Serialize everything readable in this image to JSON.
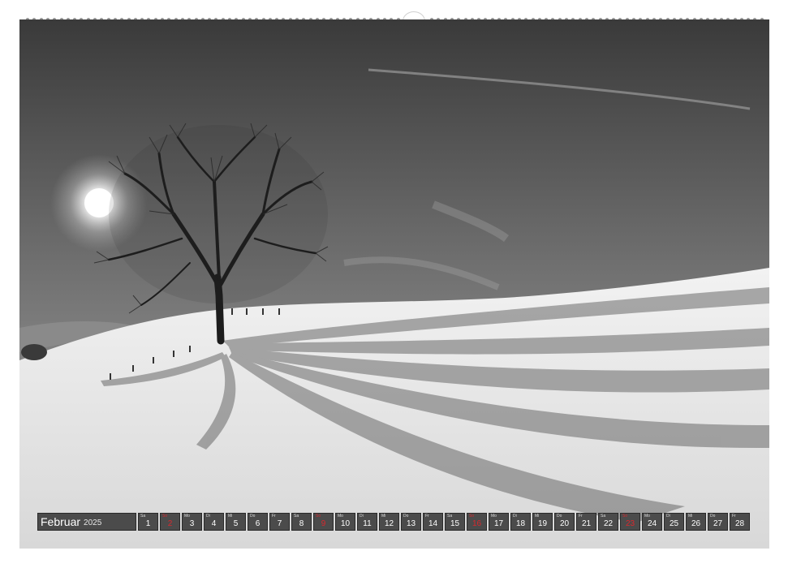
{
  "calendar": {
    "month": "Februar",
    "year": "2025",
    "days": [
      {
        "num": "1",
        "wd": "Sa",
        "sunday": false
      },
      {
        "num": "2",
        "wd": "So",
        "sunday": true
      },
      {
        "num": "3",
        "wd": "Mo",
        "sunday": false
      },
      {
        "num": "4",
        "wd": "Di",
        "sunday": false
      },
      {
        "num": "5",
        "wd": "Mi",
        "sunday": false
      },
      {
        "num": "6",
        "wd": "Do",
        "sunday": false
      },
      {
        "num": "7",
        "wd": "Fr",
        "sunday": false
      },
      {
        "num": "8",
        "wd": "Sa",
        "sunday": false
      },
      {
        "num": "9",
        "wd": "So",
        "sunday": true
      },
      {
        "num": "10",
        "wd": "Mo",
        "sunday": false
      },
      {
        "num": "11",
        "wd": "Di",
        "sunday": false
      },
      {
        "num": "12",
        "wd": "Mi",
        "sunday": false
      },
      {
        "num": "13",
        "wd": "Do",
        "sunday": false
      },
      {
        "num": "14",
        "wd": "Fr",
        "sunday": false
      },
      {
        "num": "15",
        "wd": "Sa",
        "sunday": false
      },
      {
        "num": "16",
        "wd": "So",
        "sunday": true
      },
      {
        "num": "17",
        "wd": "Mo",
        "sunday": false
      },
      {
        "num": "18",
        "wd": "Di",
        "sunday": false
      },
      {
        "num": "19",
        "wd": "Mi",
        "sunday": false
      },
      {
        "num": "20",
        "wd": "Do",
        "sunday": false
      },
      {
        "num": "21",
        "wd": "Fr",
        "sunday": false
      },
      {
        "num": "22",
        "wd": "Sa",
        "sunday": false
      },
      {
        "num": "23",
        "wd": "So",
        "sunday": true
      },
      {
        "num": "24",
        "wd": "Mo",
        "sunday": false
      },
      {
        "num": "25",
        "wd": "Di",
        "sunday": false
      },
      {
        "num": "26",
        "wd": "Mi",
        "sunday": false
      },
      {
        "num": "27",
        "wd": "Do",
        "sunday": false
      },
      {
        "num": "28",
        "wd": "Fr",
        "sunday": false
      }
    ]
  },
  "colors": {
    "sunday": "#d8282e",
    "cell": "#4b4b4b"
  }
}
